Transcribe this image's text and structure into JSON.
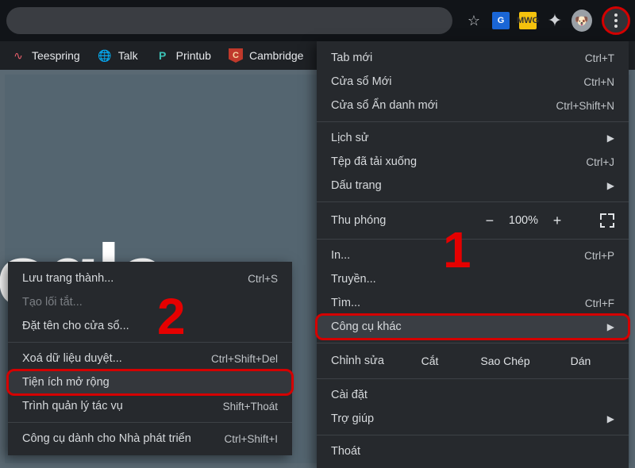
{
  "topbar": {
    "star_title": "Bookmark",
    "translate_title": "Google Translate",
    "mwg_badge": "MWG",
    "extensions_title": "Extensions",
    "avatar_emoji": "🐶",
    "kebab_title": "Customize and control Google Chrome"
  },
  "bookmarks": [
    {
      "icon": "∿",
      "label": "Teespring",
      "name": "bookmark-teespring"
    },
    {
      "icon": "🌐",
      "label": "Talk",
      "name": "bookmark-talk"
    },
    {
      "icon": "P",
      "label": "Printub",
      "name": "bookmark-printub"
    },
    {
      "icon": "shield",
      "label": "Cambridge",
      "name": "bookmark-cambridge"
    }
  ],
  "page": {
    "logo_fragment": "oogle"
  },
  "menu": {
    "new_tab": {
      "label": "Tab mới",
      "shortcut": "Ctrl+T"
    },
    "new_window": {
      "label": "Cửa sổ Mới",
      "shortcut": "Ctrl+N"
    },
    "incognito": {
      "label": "Cửa sổ Ẩn danh mới",
      "shortcut": "Ctrl+Shift+N"
    },
    "history": {
      "label": "Lịch sử"
    },
    "downloads": {
      "label": "Tệp đã tải xuống",
      "shortcut": "Ctrl+J"
    },
    "bookmarks": {
      "label": "Dấu trang"
    },
    "zoom": {
      "label": "Thu phóng",
      "value": "100%",
      "minus": "−",
      "plus": "+"
    },
    "print": {
      "label": "In...",
      "shortcut": "Ctrl+P"
    },
    "cast": {
      "label": "Truyền..."
    },
    "find": {
      "label": "Tìm...",
      "shortcut": "Ctrl+F"
    },
    "more_tools": {
      "label": "Công cụ khác"
    },
    "edit": {
      "label": "Chỉnh sửa",
      "cut": "Cắt",
      "copy": "Sao Chép",
      "paste": "Dán"
    },
    "settings": {
      "label": "Cài đặt"
    },
    "help": {
      "label": "Trợ giúp"
    },
    "exit": {
      "label": "Thoát"
    }
  },
  "submenu": {
    "save_as": {
      "label": "Lưu trang thành...",
      "shortcut": "Ctrl+S"
    },
    "shortcut": {
      "label": "Tạo lối tắt..."
    },
    "name_window": {
      "label": "Đặt tên cho cửa sổ..."
    },
    "clear_data": {
      "label": "Xoá dữ liệu duyệt...",
      "shortcut": "Ctrl+Shift+Del"
    },
    "extensions": {
      "label": "Tiện ích mở rộng"
    },
    "task_mgr": {
      "label": "Trình quản lý tác vụ",
      "shortcut": "Shift+Thoát"
    },
    "dev_tools": {
      "label": "Công cụ dành cho Nhà phát triển",
      "shortcut": "Ctrl+Shift+I"
    }
  },
  "annotations": {
    "one": "1",
    "two": "2"
  }
}
